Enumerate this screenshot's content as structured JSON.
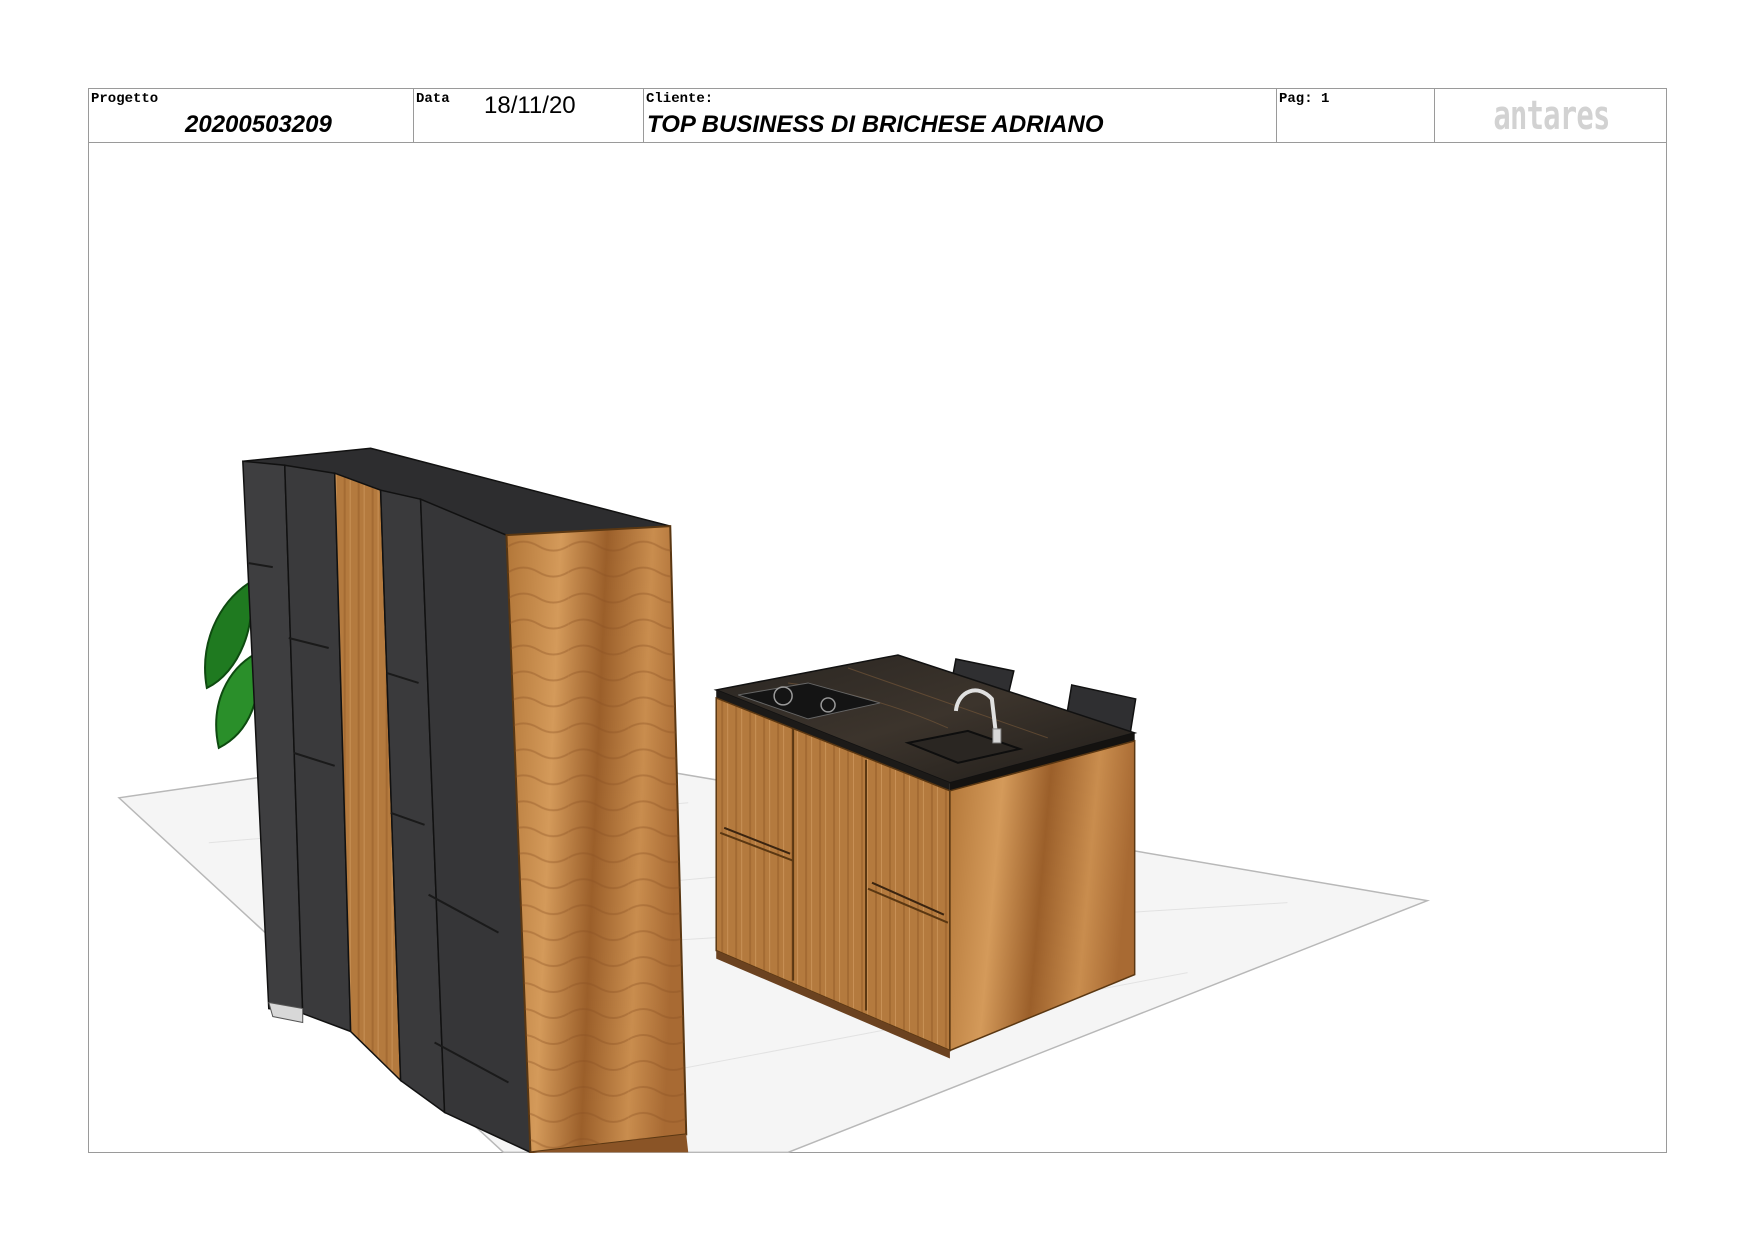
{
  "header": {
    "project_label": "Progetto",
    "project_value": "20200503209",
    "date_label": "Data",
    "date_value": "18/11/20",
    "client_label": "Cliente:",
    "client_value": "TOP BUSINESS DI BRICHESE ADRIANO",
    "page_label": "Pag: 1",
    "logo_text": "antares"
  },
  "render": {
    "subject": "kitchen-3d-render",
    "colors": {
      "wood_light": "#c98d4e",
      "wood_dark": "#8a5426",
      "anthracite": "#3a3a3c",
      "marble_top": "#2e2b28",
      "plant_green": "#1f7a20",
      "rug": "#f4f4f4"
    }
  }
}
